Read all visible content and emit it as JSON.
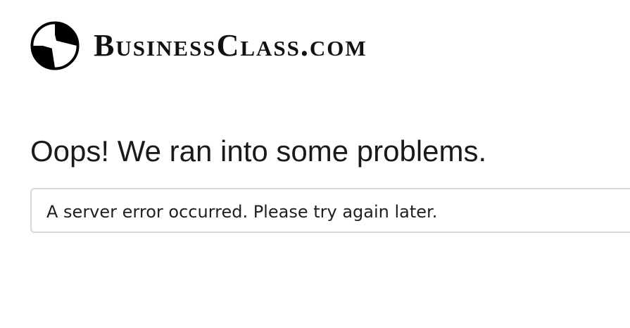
{
  "brand": {
    "logo_icon": "circle-plane-logo-icon",
    "name": "BusinessClass.com"
  },
  "error": {
    "title": "Oops! We ran into some problems.",
    "message": "A server error occurred. Please try again later."
  }
}
